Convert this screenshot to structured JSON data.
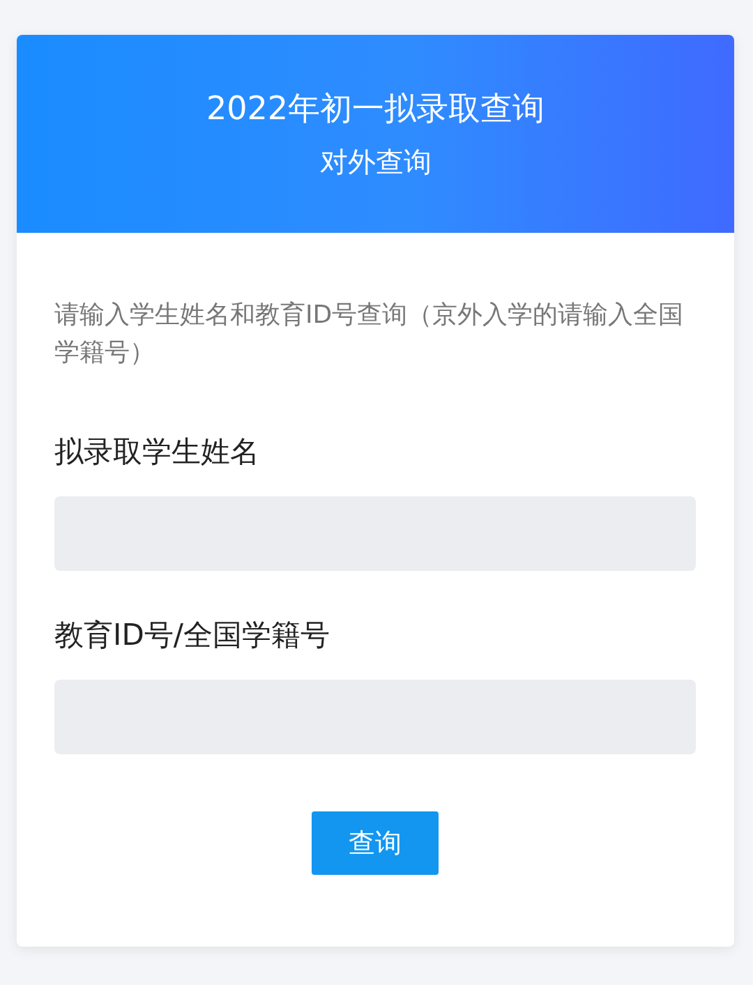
{
  "header": {
    "title": "2022年初一拟录取查询",
    "subtitle": "对外查询"
  },
  "instruction": "请输入学生姓名和教育ID号查询（京外入学的请输入全国学籍号）",
  "fields": [
    {
      "label": "拟录取学生姓名"
    },
    {
      "label": "教育ID号/全国学籍号"
    }
  ],
  "submit": "查询"
}
